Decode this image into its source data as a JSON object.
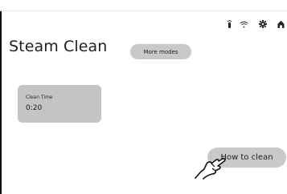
{
  "status_bar": {
    "icons": [
      "remote-control-icon",
      "wifi-icon",
      "settings-icon",
      "home-icon"
    ]
  },
  "header": {
    "title": "Steam Clean",
    "more_modes_label": "More modes"
  },
  "clean_time": {
    "label": "Clean Time",
    "value": "0:20"
  },
  "help": {
    "how_to_clean_label": "How to clean"
  },
  "colors": {
    "background": "#ffffff",
    "button_gray": "#c9c9c9",
    "tile_gray": "#c4c4c4",
    "text": "#1f1f1f"
  }
}
